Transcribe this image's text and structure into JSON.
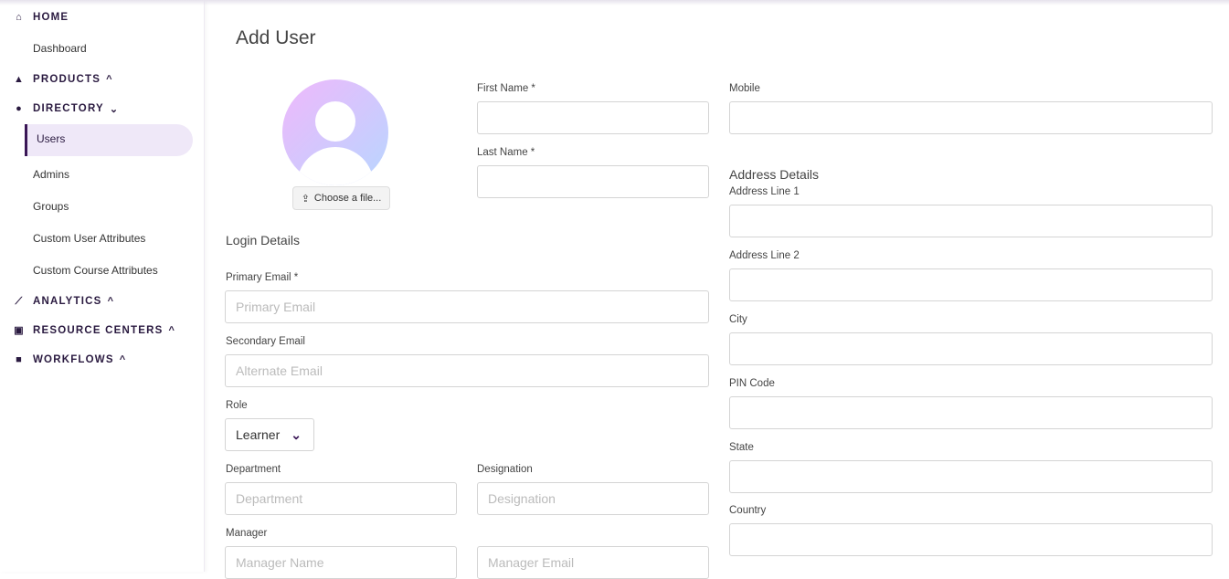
{
  "sidebar": {
    "home": "HOME",
    "dashboard": "Dashboard",
    "products": "PRODUCTS",
    "directory": "DIRECTORY",
    "users": "Users",
    "admins": "Admins",
    "groups": "Groups",
    "custom_user_attributes": "Custom User Attributes",
    "custom_course_attributes": "Custom Course Attributes",
    "analytics": "ANALYTICS",
    "resource_centers": "RESOURCE CENTERS",
    "workflows": "WORKFLOWS"
  },
  "page": {
    "title": "Add User",
    "choose_file": "Choose a file..."
  },
  "form": {
    "first_name": "First Name *",
    "last_name": "Last Name *",
    "mobile": "Mobile",
    "login_details": "Login Details",
    "primary_email": "Primary Email *",
    "primary_email_ph": "Primary Email",
    "secondary_email": "Secondary Email",
    "secondary_email_ph": "Alternate Email",
    "role": "Role",
    "role_value": "Learner",
    "department": "Department",
    "department_ph": "Department",
    "designation": "Designation",
    "designation_ph": "Designation",
    "manager": "Manager",
    "manager_name_ph": "Manager Name",
    "manager_email_ph": "Manager Email",
    "address_details": "Address Details",
    "address1": "Address Line 1",
    "address2": "Address Line 2",
    "city": "City",
    "pin": "PIN Code",
    "state": "State",
    "country": "Country"
  }
}
